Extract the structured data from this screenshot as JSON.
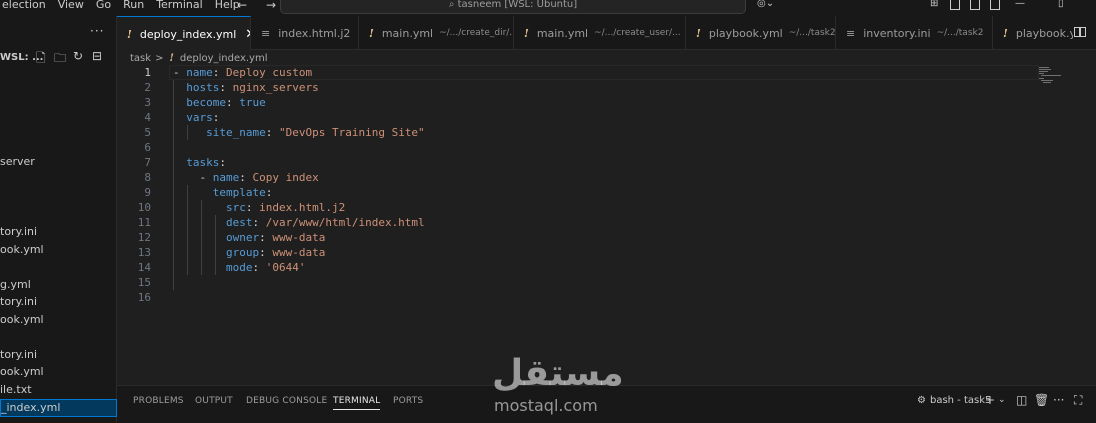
{
  "menu": [
    "election",
    "View",
    "Go",
    "Run",
    "Terminal",
    "Help"
  ],
  "nav": {
    "back": "←",
    "forward": "→"
  },
  "command_center": {
    "text": "⌕ tasneem [WSL: Ubuntu]"
  },
  "sidebar": {
    "more": "···",
    "explorer_title": "WSL: ...",
    "items": [
      {
        "label": "server"
      },
      {
        "label": "tory.ini"
      },
      {
        "label": "ook.yml"
      },
      {
        "label": "g.yml"
      },
      {
        "label": "tory.ini"
      },
      {
        "label": "ook.yml"
      },
      {
        "label": "tory.ini"
      },
      {
        "label": "ook.yml"
      },
      {
        "label": "ile.txt"
      },
      {
        "label": "_index.yml"
      }
    ]
  },
  "tabs": [
    {
      "icon": "!",
      "label": "deploy_index.yml",
      "desc": "",
      "active": true
    },
    {
      "icon": "≡",
      "label": "index.html.j2",
      "desc": ""
    },
    {
      "icon": "!",
      "label": "main.yml",
      "desc": "~/.../create_dir/..."
    },
    {
      "icon": "!",
      "label": "main.yml",
      "desc": "~/.../create_user/..."
    },
    {
      "icon": "!",
      "label": "playbook.yml",
      "desc": "~/.../task2"
    },
    {
      "icon": "≡",
      "label": "inventory.ini",
      "desc": "~/.../task2"
    },
    {
      "icon": "!",
      "label": "playbook.y",
      "desc": ""
    }
  ],
  "breadcrumb": {
    "folder": "task",
    "separator": ">",
    "file": "deploy_index.yml"
  },
  "editor": {
    "line_numbers": [
      "1",
      "2",
      "3",
      "4",
      "5",
      "6",
      "7",
      "8",
      "9",
      "10",
      "11",
      "12",
      "13",
      "14",
      "15",
      "16"
    ],
    "lines": [
      [
        [
          "p",
          "- "
        ],
        [
          "k",
          "name"
        ],
        [
          "p",
          ": "
        ],
        [
          "s",
          "Deploy custom"
        ]
      ],
      [
        [
          "p",
          "  "
        ],
        [
          "k",
          "hosts"
        ],
        [
          "p",
          ": "
        ],
        [
          "s",
          "nginx_servers"
        ]
      ],
      [
        [
          "p",
          "  "
        ],
        [
          "k",
          "become"
        ],
        [
          "p",
          ": "
        ],
        [
          "k",
          "true"
        ]
      ],
      [
        [
          "p",
          "  "
        ],
        [
          "k",
          "vars"
        ],
        [
          "p",
          ":"
        ]
      ],
      [
        [
          "p",
          "     "
        ],
        [
          "k",
          "site_name"
        ],
        [
          "p",
          ": "
        ],
        [
          "s",
          "\"DevOps Training Site\""
        ]
      ],
      [],
      [
        [
          "p",
          "  "
        ],
        [
          "k",
          "tasks"
        ],
        [
          "p",
          ":"
        ]
      ],
      [
        [
          "p",
          "    - "
        ],
        [
          "k",
          "name"
        ],
        [
          "p",
          ": "
        ],
        [
          "s",
          "Copy index"
        ]
      ],
      [
        [
          "p",
          "      "
        ],
        [
          "k",
          "template"
        ],
        [
          "p",
          ":"
        ]
      ],
      [
        [
          "p",
          "        "
        ],
        [
          "k",
          "src"
        ],
        [
          "p",
          ": "
        ],
        [
          "s",
          "index.html.j2"
        ]
      ],
      [
        [
          "p",
          "        "
        ],
        [
          "k",
          "dest"
        ],
        [
          "p",
          ": "
        ],
        [
          "s",
          "/var/www/html/index.html"
        ]
      ],
      [
        [
          "p",
          "        "
        ],
        [
          "k",
          "owner"
        ],
        [
          "p",
          ": "
        ],
        [
          "s",
          "www-data"
        ]
      ],
      [
        [
          "p",
          "        "
        ],
        [
          "k",
          "group"
        ],
        [
          "p",
          ": "
        ],
        [
          "s",
          "www-data"
        ]
      ],
      [
        [
          "p",
          "        "
        ],
        [
          "k",
          "mode"
        ],
        [
          "p",
          ": "
        ],
        [
          "s",
          "'0644'"
        ]
      ],
      [],
      []
    ]
  },
  "panel": {
    "tabs": [
      "PROBLEMS",
      "OUTPUT",
      "DEBUG CONSOLE",
      "TERMINAL",
      "PORTS"
    ],
    "active_tab": "TERMINAL",
    "terminal_name": "bash - task5"
  },
  "watermark": {
    "arabic": "مستقل",
    "latin": "mostaql.com"
  },
  "colors": {
    "accent": "#0078d4",
    "key": "#569cd6",
    "string": "#ce9178",
    "yaml_icon": "#e2c08d"
  }
}
